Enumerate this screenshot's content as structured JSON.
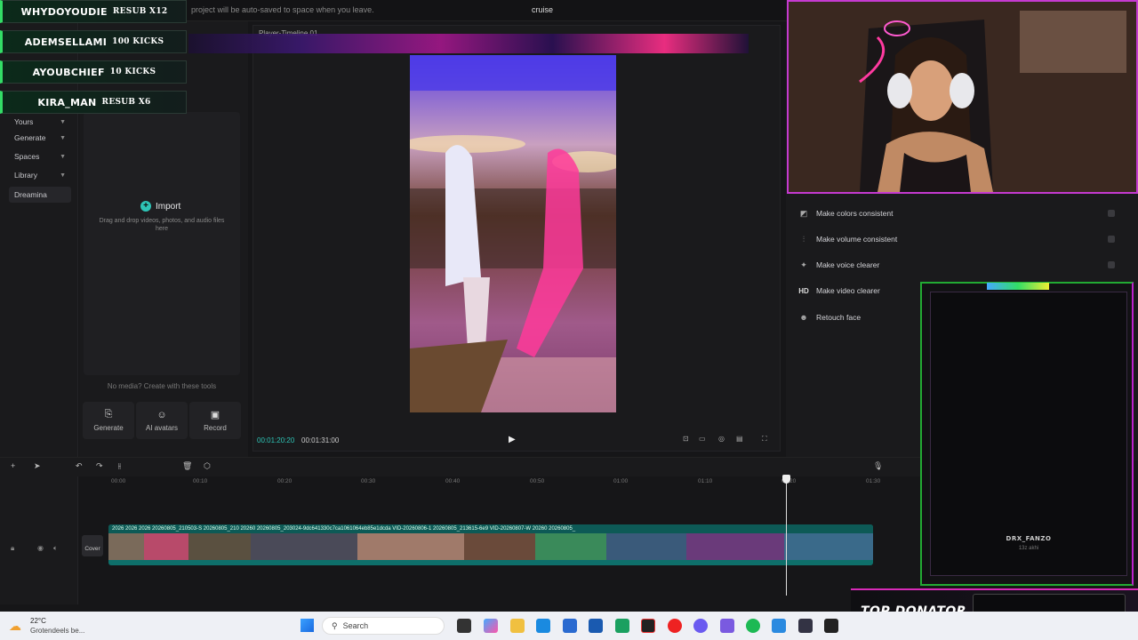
{
  "topbar": {
    "autosave_note": "project will be auto-saved to space when you leave.",
    "project_title": "cruise"
  },
  "stream_alerts": [
    {
      "name": "WHYDOYOUDIE",
      "action": "RESUB X12"
    },
    {
      "name": "ADEMSELLAMI",
      "action": "100 KICKS"
    },
    {
      "name": "AYOUBCHIEF",
      "action": "10 KICKS"
    },
    {
      "name": "KIRA_MAN",
      "action": "RESUB X6"
    }
  ],
  "sidebar": {
    "items": [
      {
        "label": "Yours"
      },
      {
        "label": "Generate"
      },
      {
        "label": "Spaces"
      },
      {
        "label": "Library"
      },
      {
        "label": "Dreamina"
      }
    ]
  },
  "media": {
    "import_label": "Import",
    "drop_hint": "Drag and drop videos, photos, and audio files here",
    "no_media": "No media? Create with these tools",
    "tools": [
      {
        "label": "Generate",
        "icon": "generate-icon"
      },
      {
        "label": "AI avatars",
        "icon": "avatar-icon"
      },
      {
        "label": "Record",
        "icon": "record-icon"
      }
    ]
  },
  "player": {
    "title": "Player-Timeline 01",
    "time_current": "00:01:20:20",
    "time_total": "00:01:31:00"
  },
  "enhance": {
    "items": [
      {
        "label": "Make colors consistent",
        "icon": "color-adjust-icon"
      },
      {
        "label": "Make volume consistent",
        "icon": "volume-bars-icon"
      },
      {
        "label": "Make voice clearer",
        "icon": "voice-icon"
      },
      {
        "label": "Make video clearer",
        "icon": "hd-icon",
        "icon_text": "HD"
      },
      {
        "label": "Retouch face",
        "icon": "retouch-icon"
      }
    ]
  },
  "timeline": {
    "ticks": [
      "00:00",
      "00:10",
      "00:20",
      "00:30",
      "00:40",
      "00:50",
      "01:00",
      "01:10",
      "01:20",
      "01:30"
    ],
    "cover_label": "Cover",
    "clip_labels": "2026 2026 2026 20260805_210503-S 20260805_210 20260 20260805_203024-9dc641330c7ca1061064eb85e1dcda VID-20260806-1 20260805_213615-6e9 VID-20260807-W 20260 20260805_"
  },
  "donor": {
    "name": "DRX_FANZO",
    "amount": "13z akhi",
    "top_label": "TOP DONATOR"
  },
  "taskbar": {
    "weather_temp": "22°C",
    "weather_desc": "Grotendeels be...",
    "search_label": "Search"
  },
  "colors": {
    "accent": "#2ec4b6",
    "stream_pink": "#d82ab8",
    "alert_green": "#33dd66"
  }
}
